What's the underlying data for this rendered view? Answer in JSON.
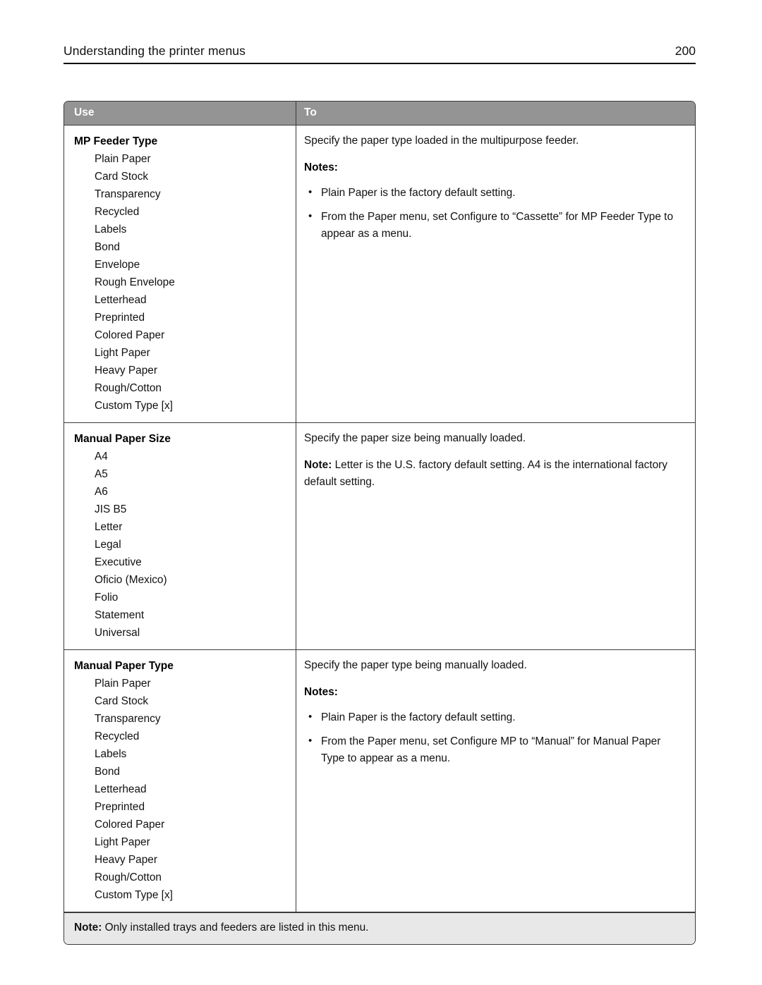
{
  "page_header": {
    "title": "Understanding the printer menus",
    "page_number": "200"
  },
  "table": {
    "columns": {
      "use": "Use",
      "to": "To"
    },
    "rows": [
      {
        "use_title": "MP Feeder Type",
        "options": [
          "Plain Paper",
          "Card Stock",
          "Transparency",
          "Recycled",
          "Labels",
          "Bond",
          "Envelope",
          "Rough Envelope",
          "Letterhead",
          "Preprinted",
          "Colored Paper",
          "Light Paper",
          "Heavy Paper",
          "Rough/Cotton",
          "Custom Type [x]"
        ],
        "to_lead": "Specify the paper type loaded in the multipurpose feeder.",
        "notes_label": "Notes:",
        "notes": [
          "Plain Paper is the factory default setting.",
          "From the Paper menu, set Configure to “Cassette” for MP Feeder Type to appear as a menu."
        ]
      },
      {
        "use_title": "Manual Paper Size",
        "options": [
          "A4",
          "A5",
          "A6",
          "JIS B5",
          "Letter",
          "Legal",
          "Executive",
          "Oficio (Mexico)",
          "Folio",
          "Statement",
          "Universal"
        ],
        "to_lead": "Specify the paper size being manually loaded.",
        "note_bold": "Note:",
        "note_text": " Letter is the U.S. factory default setting. A4 is the international factory default setting."
      },
      {
        "use_title": "Manual Paper Type",
        "options": [
          "Plain Paper",
          "Card Stock",
          "Transparency",
          "Recycled",
          "Labels",
          "Bond",
          "Letterhead",
          "Preprinted",
          "Colored Paper",
          "Light Paper",
          "Heavy Paper",
          "Rough/Cotton",
          "Custom Type [x]"
        ],
        "to_lead": "Specify the paper type being manually loaded.",
        "notes_label": "Notes:",
        "notes": [
          "Plain Paper is the factory default setting.",
          "From the Paper menu, set Configure MP to “Manual” for Manual Paper Type to appear as a menu."
        ]
      }
    ],
    "footer_note_bold": "Note:",
    "footer_note_text": " Only installed trays and feeders are listed in this menu."
  },
  "colors": {
    "header_row_background": "#949494",
    "header_row_text": "#ffffff",
    "footer_row_background": "#e8e8e8",
    "border": "#3a3a3a",
    "body_text": "#111111"
  }
}
